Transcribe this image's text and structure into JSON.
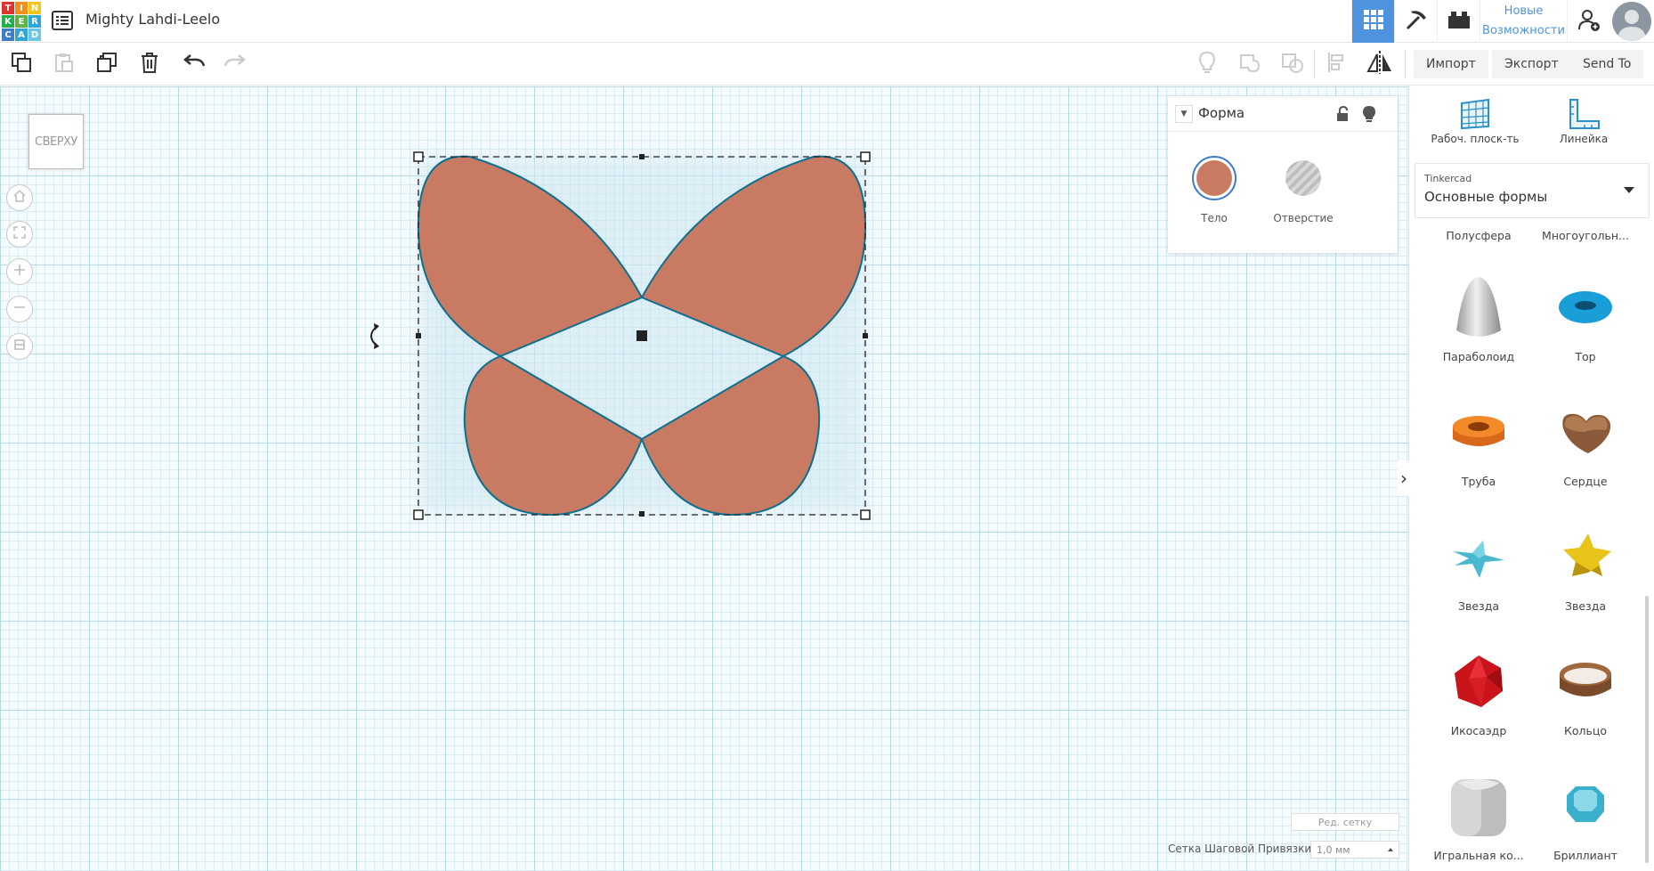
{
  "app": {
    "logo_letters": [
      "T",
      "I",
      "N",
      "K",
      "E",
      "R",
      "C",
      "A",
      "D"
    ],
    "logo_colors": [
      "#e1332d",
      "#f38f1c",
      "#f4c51c",
      "#22b04a",
      "#5cb646",
      "#2aa8de",
      "#3d7cc9",
      "#2ea7d8",
      "#6cc7e6"
    ],
    "design_title": "Mighty Lahdi-Leelo"
  },
  "topbar": {
    "whats_new_line1": "Новые",
    "whats_new_line2": "Возможности",
    "accent_color": "#4e93de"
  },
  "toolbar": {
    "import_label": "Импорт",
    "export_label": "Экспорт",
    "sendto_label": "Send To"
  },
  "viewcube": {
    "label": "СВЕРХУ"
  },
  "shape_panel": {
    "title": "Форма",
    "solid_label": "Тело",
    "hole_label": "Отверстие",
    "solid_color": "#c87a62"
  },
  "sidebar": {
    "workplane_label": "Рабоч. плоск-ть",
    "ruler_label": "Линейка",
    "library_source": "Tinkercad",
    "library_name": "Основные формы",
    "partial_labels": [
      "Полусфера",
      "Многоугольн..."
    ],
    "shapes": [
      {
        "label": "Параболоид",
        "icon": "paraboloid-icon"
      },
      {
        "label": "Тор",
        "icon": "torus-icon"
      },
      {
        "label": "Труба",
        "icon": "tube-icon"
      },
      {
        "label": "Сердце",
        "icon": "heart-icon"
      },
      {
        "label": "Звезда",
        "icon": "star-blue-icon"
      },
      {
        "label": "Звезда",
        "icon": "star-yellow-icon"
      },
      {
        "label": "Икосаэдр",
        "icon": "icosahedron-icon"
      },
      {
        "label": "Кольцо",
        "icon": "ring-icon"
      },
      {
        "label": "Игральная ко...",
        "icon": "dice-icon"
      },
      {
        "label": "Бриллиант",
        "icon": "diamond-icon"
      }
    ]
  },
  "grid_controls": {
    "edit_grid_label": "Ред. сетку",
    "snap_label": "Сетка Шаговой Привязки",
    "snap_value": "1,0 мм"
  }
}
